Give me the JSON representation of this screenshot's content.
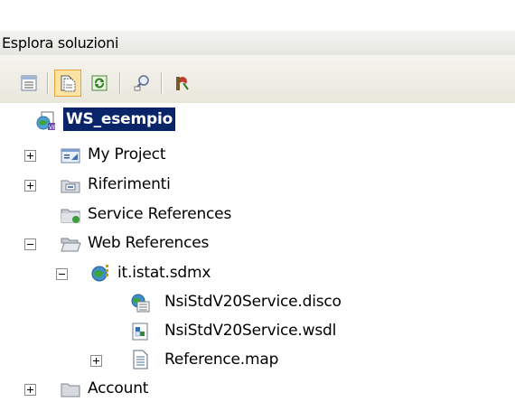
{
  "panel": {
    "title": "Esplora soluzioni"
  },
  "toolbar": {
    "buttons": [
      {
        "icon": "properties-icon"
      },
      {
        "icon": "show-all-files-icon",
        "active": true
      },
      {
        "icon": "refresh-icon"
      },
      {
        "icon": "class-diagram-icon"
      },
      {
        "icon": "copy-website-icon"
      }
    ]
  },
  "tree": {
    "root": "WS_esempio",
    "my_project": "My Project",
    "riferimenti": "Riferimenti",
    "service_references": "Service References",
    "web_references": "Web References",
    "web_ref_item": "it.istat.sdmx",
    "disco_file": "NsiStdV20Service.disco",
    "wsdl_file": "NsiStdV20Service.wsdl",
    "map_file": "Reference.map",
    "account_folder": "Account"
  },
  "colors": {
    "selection": "#0a246a",
    "toolbar_active": "#fde3a3"
  }
}
